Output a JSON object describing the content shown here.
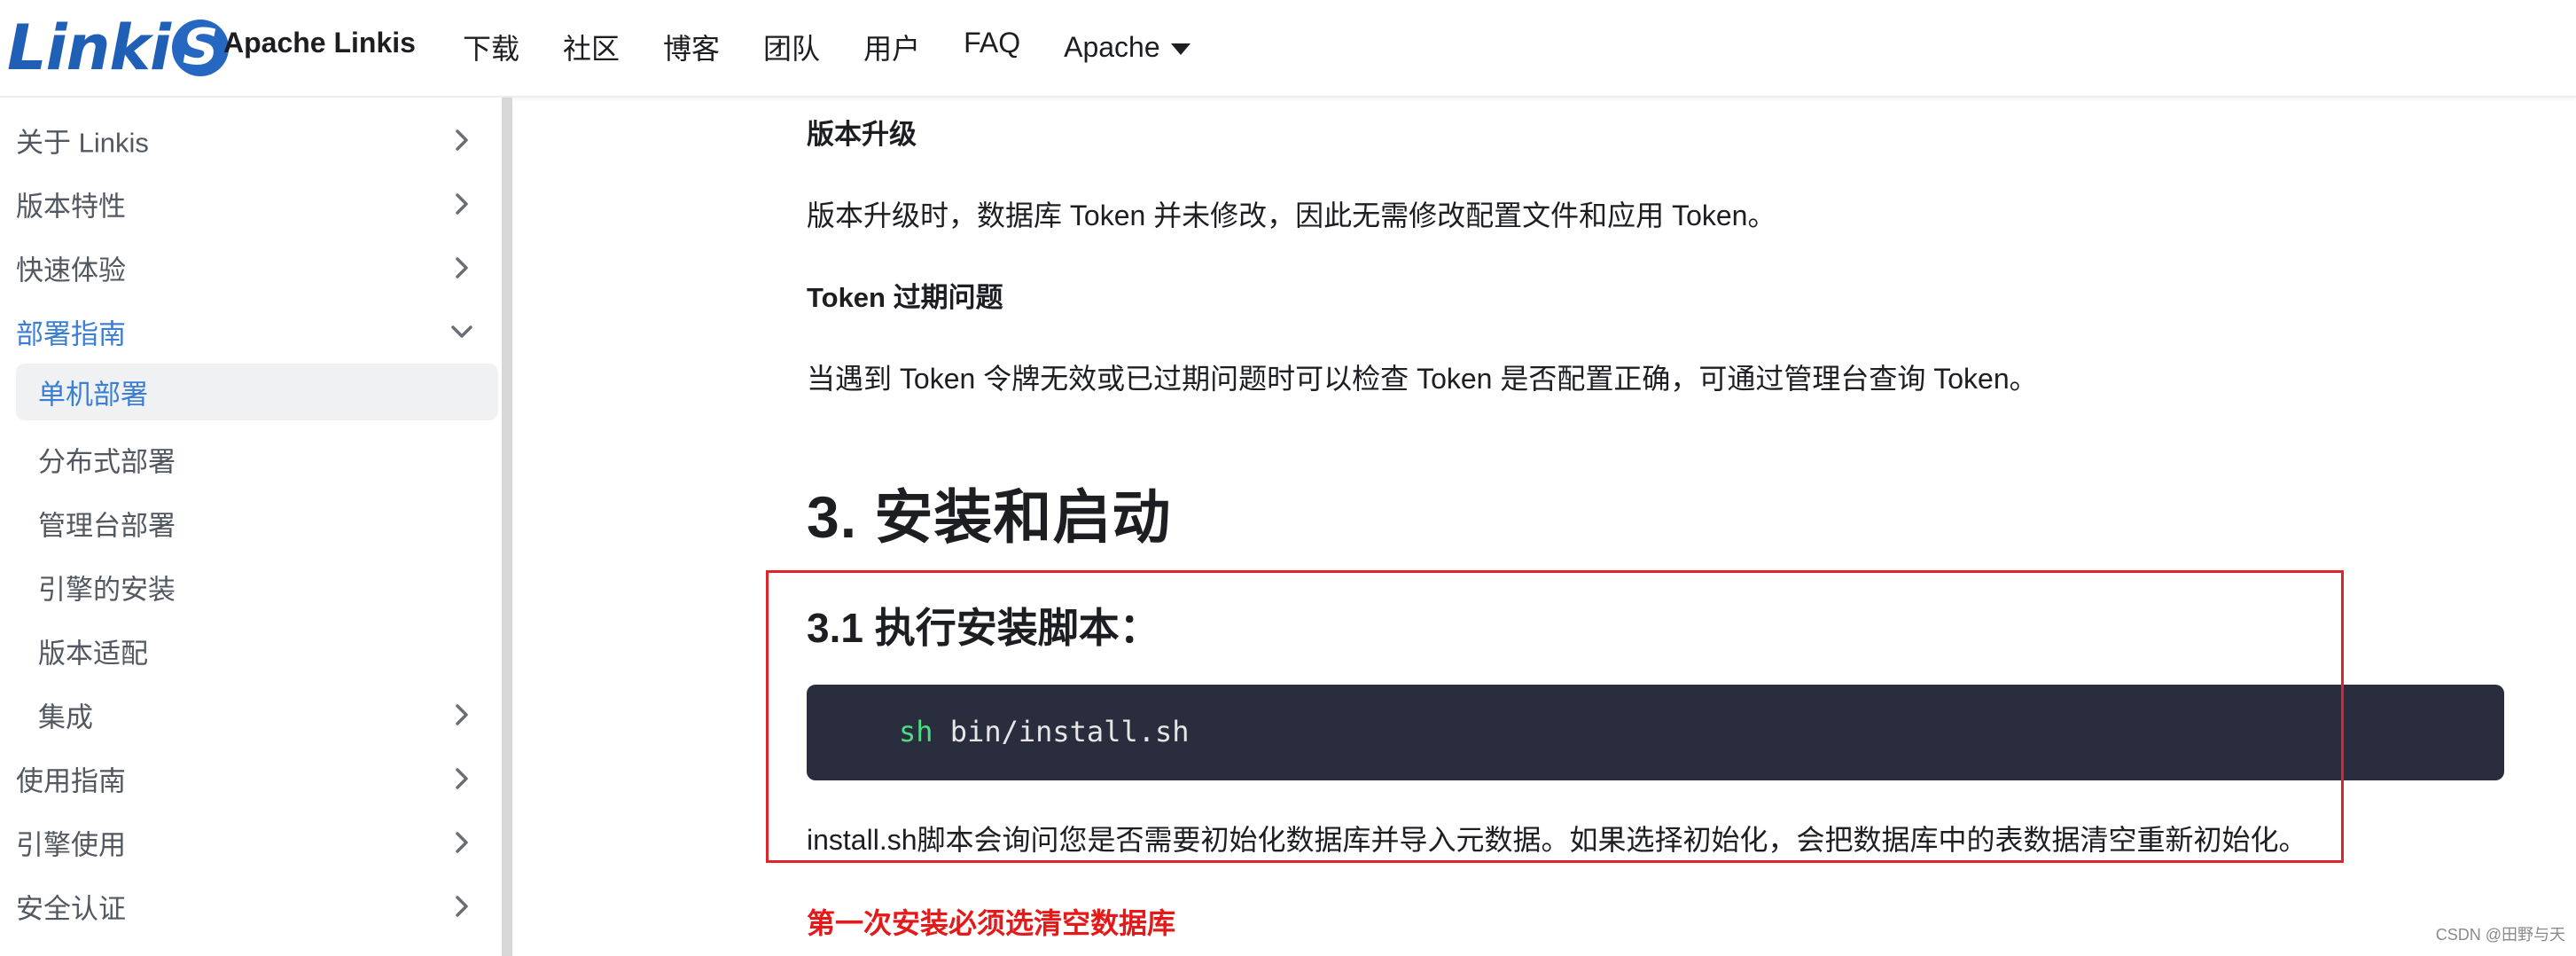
{
  "header": {
    "logo_text": "Linkis",
    "brand_title": "Apache Linkis",
    "nav": [
      {
        "label": "下载"
      },
      {
        "label": "社区"
      },
      {
        "label": "博客"
      },
      {
        "label": "团队"
      },
      {
        "label": "用户"
      },
      {
        "label": "FAQ"
      },
      {
        "label": "Apache"
      }
    ]
  },
  "sidebar": {
    "items": [
      {
        "label": "关于 Linkis",
        "icon": "chevron-right-icon"
      },
      {
        "label": "版本特性",
        "icon": "chevron-right-icon"
      },
      {
        "label": "快速体验",
        "icon": "chevron-right-icon"
      },
      {
        "label": "部署指南",
        "icon": "chevron-down-icon"
      },
      {
        "label": "单机部署"
      },
      {
        "label": "分布式部署"
      },
      {
        "label": "管理台部署"
      },
      {
        "label": "引擎的安装"
      },
      {
        "label": "版本适配"
      },
      {
        "label": "集成",
        "icon": "chevron-right-icon"
      },
      {
        "label": "使用指南",
        "icon": "chevron-right-icon"
      },
      {
        "label": "引擎使用",
        "icon": "chevron-right-icon"
      },
      {
        "label": "安全认证",
        "icon": "chevron-right-icon"
      }
    ]
  },
  "main": {
    "h_upgrade": "版本升级",
    "p_upgrade": "版本升级时，数据库 Token 并未修改，因此无需修改配置文件和应用 Token。",
    "h_expire": "Token 过期问题",
    "p_expire": "当遇到 Token 令牌无效或已过期问题时可以检查 Token 是否配置正确，可通过管理台查询 Token。",
    "section_title": "3. 安装和启动",
    "subsection_title": "3.1 执行安装脚本：",
    "code": {
      "keyword": "sh",
      "rest": " bin/install.sh"
    },
    "p_install": "install.sh脚本会询问您是否需要初始化数据库并导入元数据。如果选择初始化，会把数据库中的表数据清空重新初始化。",
    "warning": "第一次安装必须选清空数据库"
  },
  "watermark": "CSDN @田野与天",
  "colors": {
    "accent": "#3a7fd5",
    "highlight_box": "#e1242b",
    "warning_text": "#e51919",
    "code_bg": "#292d3e"
  }
}
